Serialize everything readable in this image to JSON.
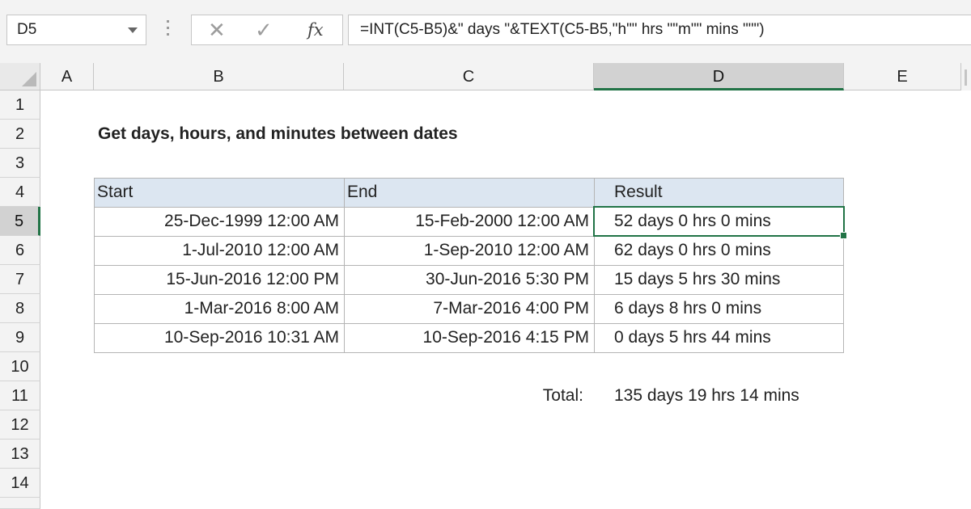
{
  "formula_bar": {
    "name_box": "D5",
    "cancel_icon": "close-x-icon",
    "enter_icon": "checkmark-icon",
    "function_icon": "fx",
    "formula": "=INT(C5-B5)&\" days \"&TEXT(C5-B5,\"h\"\" hrs \"\"m\"\" mins \"\"\")"
  },
  "columns": [
    "A",
    "B",
    "C",
    "D",
    "E"
  ],
  "rows": [
    "1",
    "2",
    "3",
    "4",
    "5",
    "6",
    "7",
    "8",
    "9",
    "10",
    "11",
    "12",
    "13",
    "14"
  ],
  "active_cell": "D5",
  "sheet": {
    "title": "Get days, hours, and minutes between dates",
    "table_headers": [
      "Start",
      "End",
      "Result"
    ],
    "table_rows": [
      [
        "25-Dec-1999 12:00 AM",
        "15-Feb-2000 12:00 AM",
        "52 days 0 hrs 0 mins"
      ],
      [
        "1-Jul-2010 12:00 AM",
        "1-Sep-2010 12:00 AM",
        "62 days 0 hrs 0 mins"
      ],
      [
        "15-Jun-2016 12:00 PM",
        "30-Jun-2016 5:30 PM",
        "15 days 5 hrs 30 mins"
      ],
      [
        "1-Mar-2016 8:00 AM",
        "7-Mar-2016 4:00 PM",
        "6 days 8 hrs 0 mins"
      ],
      [
        "10-Sep-2016 10:31 AM",
        "10-Sep-2016 4:15 PM",
        "0 days 5 hrs 44 mins"
      ]
    ],
    "total_label": "Total:",
    "total_value": "135 days 19 hrs 14 mins"
  },
  "colors": {
    "accent": "#217346",
    "header_fill": "#dce6f1"
  }
}
